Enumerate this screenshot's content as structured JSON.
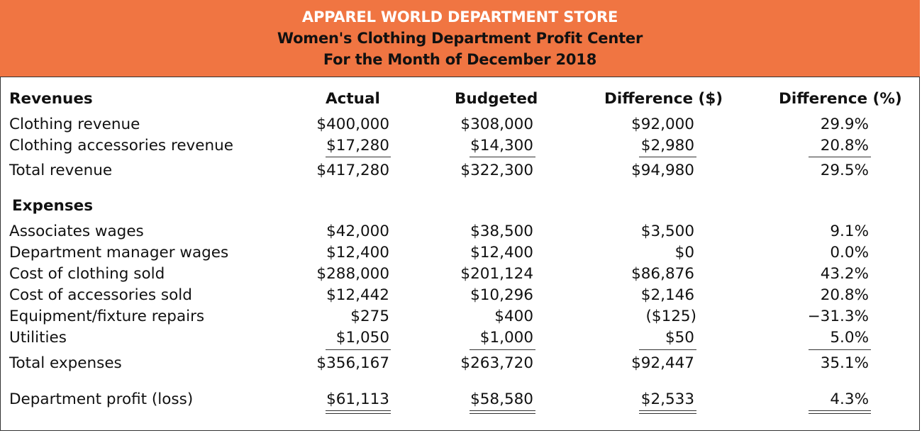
{
  "header": {
    "company": "APPAREL WORLD DEPARTMENT STORE",
    "report": "Women's Clothing Department Profit Center",
    "period": "For the Month of December 2018"
  },
  "columns": {
    "section_revenues": "Revenues",
    "actual": "Actual",
    "budgeted": "Budgeted",
    "difference_dollar": "Difference ($)",
    "difference_percent": "Difference (%)"
  },
  "revenues": [
    {
      "label": "Clothing revenue",
      "actual": "$400,000",
      "budgeted": "$308,000",
      "diff": "$92,000",
      "pct": "29.9%"
    },
    {
      "label": "Clothing accessories revenue",
      "actual": "$17,280",
      "budgeted": "$14,300",
      "diff": "$2,980",
      "pct": "20.8%"
    }
  ],
  "total_revenue": {
    "label": "Total revenue",
    "actual": "$417,280",
    "budgeted": "$322,300",
    "diff": "$94,980",
    "pct": "29.5%"
  },
  "expenses_heading": "Expenses",
  "expenses": [
    {
      "label": "Associates wages",
      "actual": "$42,000",
      "budgeted": "$38,500",
      "diff": "$3,500",
      "pct": "9.1%"
    },
    {
      "label": "Department manager wages",
      "actual": "$12,400",
      "budgeted": "$12,400",
      "diff": "$0",
      "pct": "0.0%"
    },
    {
      "label": "Cost of clothing sold",
      "actual": "$288,000",
      "budgeted": "$201,124",
      "diff": "$86,876",
      "pct": "43.2%"
    },
    {
      "label": "Cost of accessories sold",
      "actual": "$12,442",
      "budgeted": "$10,296",
      "diff": "$2,146",
      "pct": "20.8%"
    },
    {
      "label": "Equipment/fixture repairs",
      "actual": "$275",
      "budgeted": "$400",
      "diff": "($125)",
      "pct": "−31.3%"
    },
    {
      "label": "Utilities",
      "actual": "$1,050",
      "budgeted": "$1,000",
      "diff": "$50",
      "pct": "5.0%"
    }
  ],
  "total_expenses": {
    "label": "Total expenses",
    "actual": "$356,167",
    "budgeted": "$263,720",
    "diff": "$92,447",
    "pct": "35.1%"
  },
  "profit": {
    "label": "Department profit (loss)",
    "actual": "$61,113",
    "budgeted": "$58,580",
    "diff": "$2,533",
    "pct": "4.3%"
  },
  "colors": {
    "header_bg": "#f07542",
    "header_title": "#ffffff",
    "text": "#111111"
  }
}
